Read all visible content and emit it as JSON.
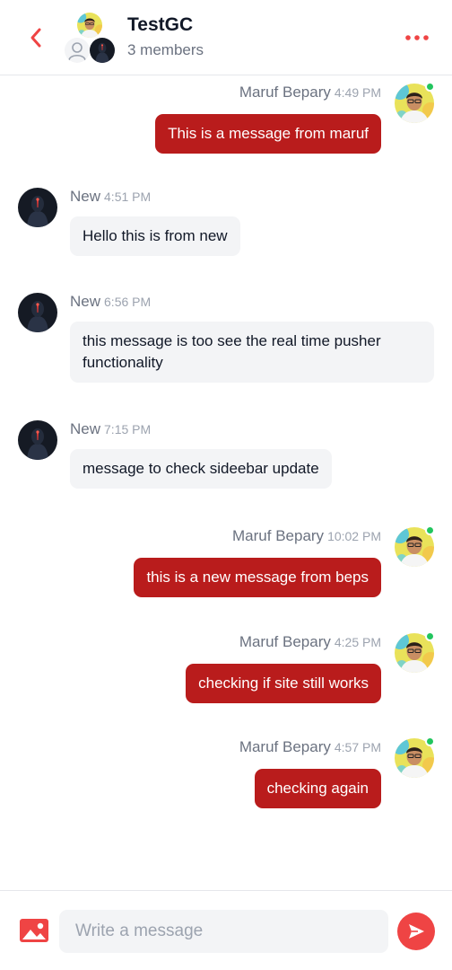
{
  "header": {
    "title": "TestGC",
    "subtitle": "3 members"
  },
  "messages": [
    {
      "sender": "Maruf Bepary",
      "time": "4:49 PM",
      "text": "This is a message from maruf",
      "outgoing": true
    },
    {
      "sender": "New",
      "time": "4:51 PM",
      "text": "Hello this is from new",
      "outgoing": false
    },
    {
      "sender": "New",
      "time": "6:56 PM",
      "text": "this message is too see the real time pusher functionality",
      "outgoing": false
    },
    {
      "sender": "New",
      "time": "7:15 PM",
      "text": "message to check sideebar update",
      "outgoing": false
    },
    {
      "sender": "Maruf Bepary",
      "time": "10:02 PM",
      "text": "this is a new message from beps",
      "outgoing": true
    },
    {
      "sender": "Maruf Bepary",
      "time": "4:25 PM",
      "text": "checking if site still works",
      "outgoing": true
    },
    {
      "sender": "Maruf Bepary",
      "time": "4:57 PM",
      "text": "checking again",
      "outgoing": true
    }
  ],
  "composer": {
    "placeholder": "Write a message"
  },
  "colors": {
    "accent": "#ef4444",
    "outgoing_bubble": "#b91c1c",
    "incoming_bubble": "#f3f4f6",
    "online": "#22c55e"
  },
  "icons": {
    "back": "chevron-left-icon",
    "more": "more-dots-icon",
    "image": "image-icon",
    "send": "send-icon"
  }
}
